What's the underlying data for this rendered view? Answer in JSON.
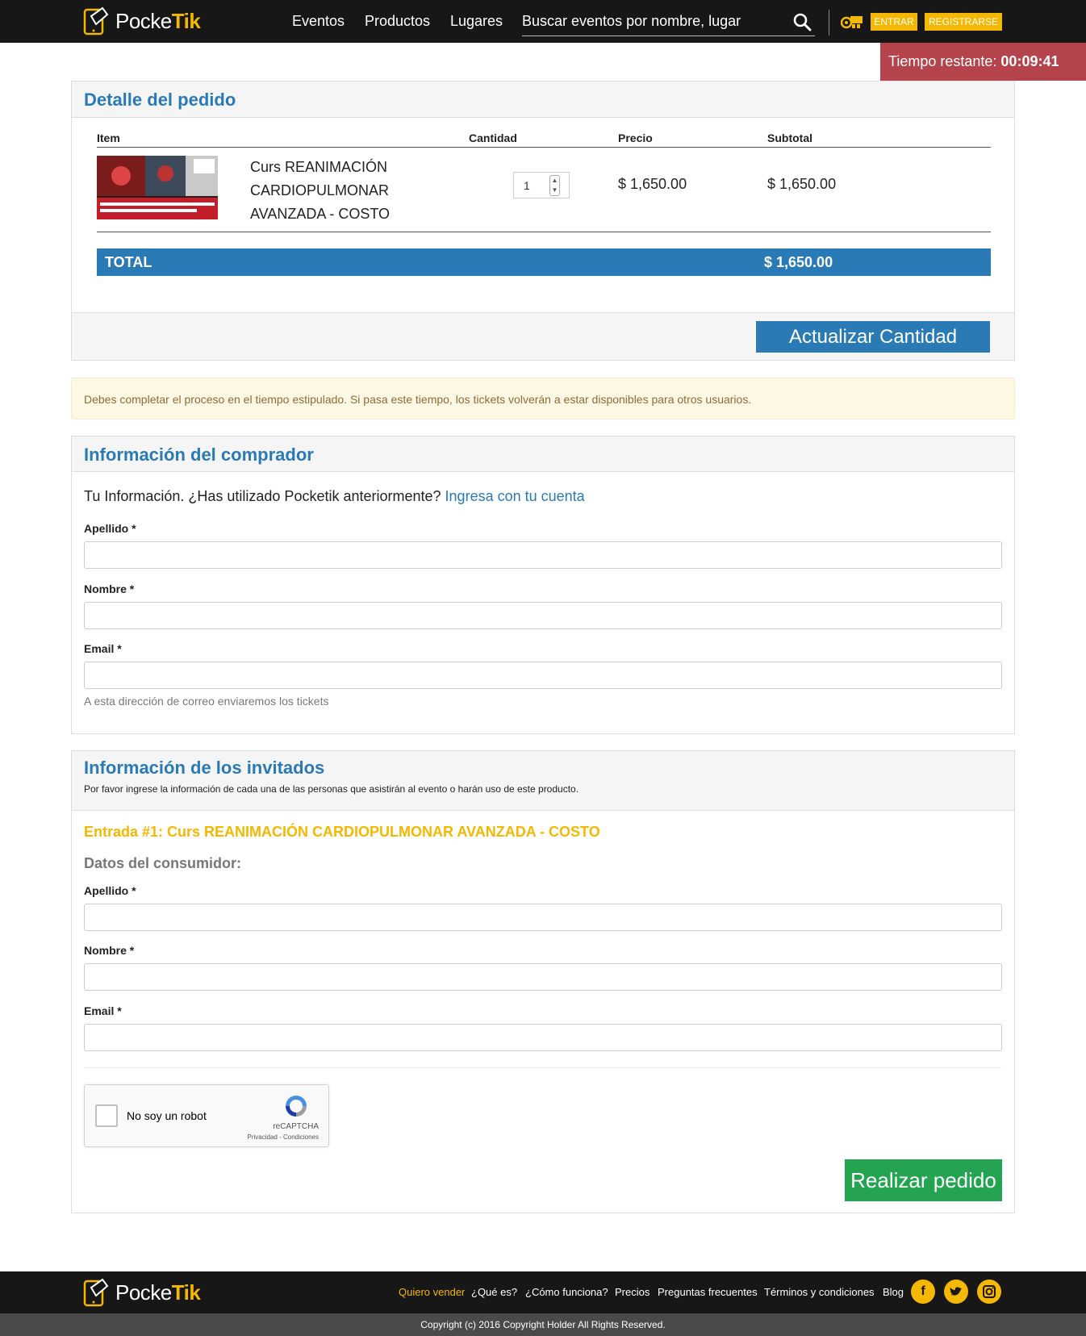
{
  "brand": {
    "logo_prefix": "Pocke",
    "logo_suffix": "Tik"
  },
  "nav": {
    "links": [
      "Eventos",
      "Productos",
      "Lugares"
    ],
    "search_placeholder": "Buscar eventos por nombre, lugar",
    "login_label": "ENTRAR",
    "register_label": "REGISTRARSE"
  },
  "timer": {
    "label": "Tiempo restante:",
    "value": "00:09:41"
  },
  "order": {
    "title": "Detalle del pedido",
    "columns": {
      "item": "Item",
      "quantity": "Cantidad",
      "price": "Precio",
      "subtotal": "Subtotal"
    },
    "items": [
      {
        "name": "Curs REANIMACIÓN CARDIOPULMONAR AVANZADA - COSTO",
        "quantity": "1",
        "price": "$ 1,650.00",
        "subtotal": "$ 1,650.00"
      }
    ],
    "total_label": "TOTAL",
    "total_value": "$ 1,650.00",
    "update_button": "Actualizar Cantidad"
  },
  "alert": "Debes completar el proceso en el tiempo estipulado. Si pasa este tiempo, los tickets volverán a estar disponibles para otros usuarios.",
  "buyer": {
    "title": "Información del comprador",
    "intro": "Tu Información. ¿Has utilizado Pocketik anteriormente?",
    "login_link": "Ingresa con tu cuenta",
    "fields": {
      "last_name": "Apellido *",
      "first_name": "Nombre *",
      "email": "Email *"
    },
    "email_help": "A esta dirección de correo enviaremos los tickets"
  },
  "guests": {
    "title": "Información de los invitados",
    "subtitle": "Por favor ingrese la información de cada una de las personas que asistirán al evento o harán uso de este producto.",
    "entry_title": "Entrada #1: Curs REANIMACIÓN CARDIOPULMONAR AVANZADA - COSTO",
    "consumer_title": "Datos del consumidor:",
    "fields": {
      "last_name": "Apellido *",
      "first_name": "Nombre *",
      "email": "Email *"
    }
  },
  "captcha": {
    "label": "No soy un robot",
    "brand": "reCAPTCHA",
    "links": "Privacidad - Condiciones"
  },
  "submit_button": "Realizar pedido",
  "footer": {
    "links": [
      "Quiero vender",
      "¿Qué es?",
      "¿Cómo funciona?",
      "Precios",
      "Preguntas frecuentes",
      "Términos y condiciones",
      "Blog"
    ],
    "social": [
      "facebook-icon",
      "twitter-icon",
      "instagram-icon"
    ],
    "copyright": "Copyright (c) 2016 Copyright Holder All Rights Reserved."
  },
  "colors": {
    "accent": "#f5b800",
    "primary": "#2a7ab5",
    "timer": "#b5434b",
    "success": "#24a350",
    "dark": "#171717"
  }
}
